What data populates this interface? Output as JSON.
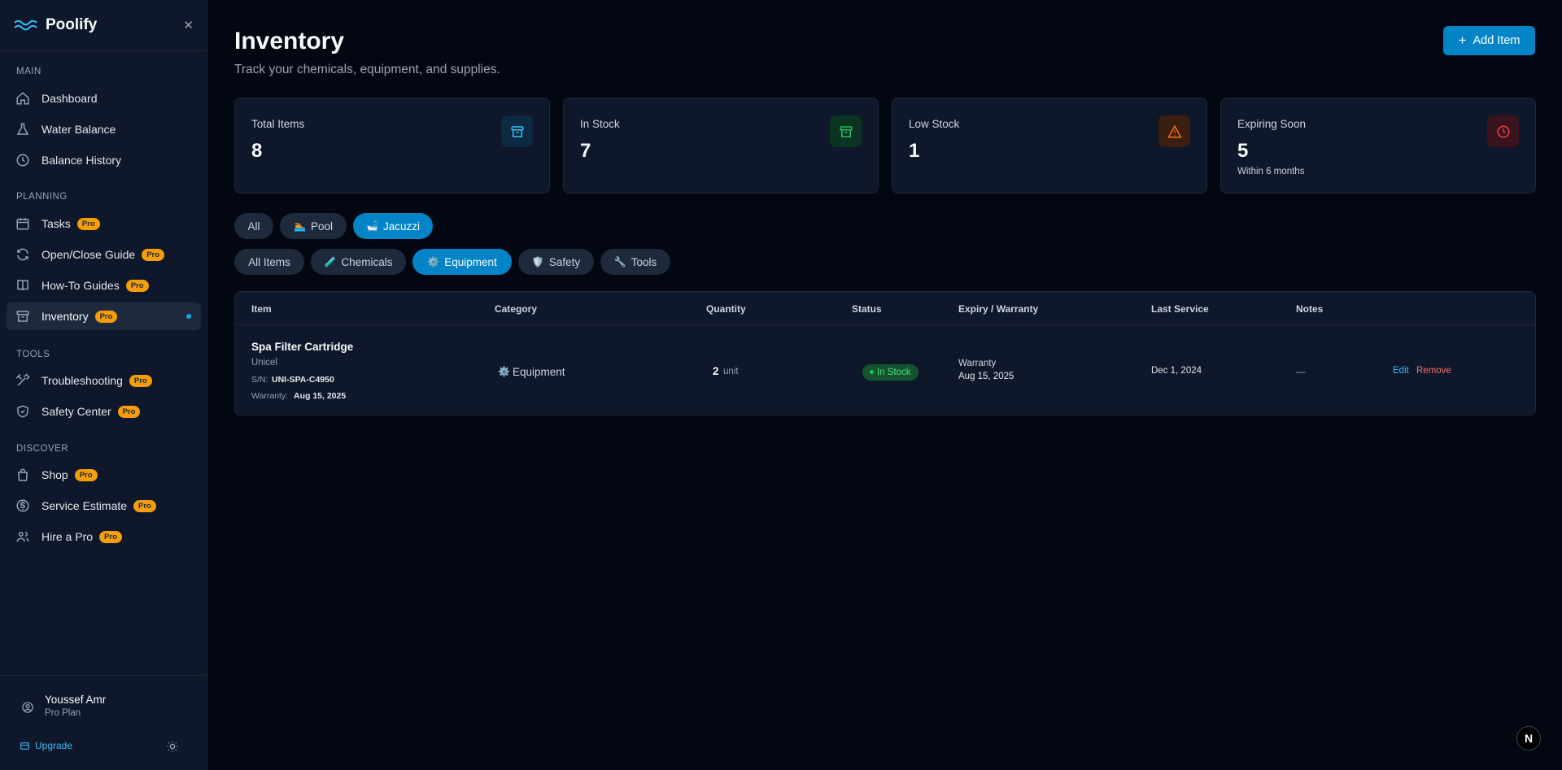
{
  "app": {
    "name": "Poolify"
  },
  "sidebar": {
    "sections": {
      "main": "MAIN",
      "planning": "PLANNING",
      "tools": "TOOLS",
      "discover": "DISCOVER"
    },
    "items": [
      {
        "label": "Dashboard",
        "icon": "home-icon",
        "pro": false
      },
      {
        "label": "Water Balance",
        "icon": "flask-icon",
        "pro": false
      },
      {
        "label": "Balance History",
        "icon": "clock-icon",
        "pro": false
      },
      {
        "label": "Tasks",
        "icon": "calendar-icon",
        "pro": true
      },
      {
        "label": "Open/Close Guide",
        "icon": "refresh-icon",
        "pro": true
      },
      {
        "label": "How-To Guides",
        "icon": "book-icon",
        "pro": true
      },
      {
        "label": "Inventory",
        "icon": "archive-icon",
        "pro": true,
        "active": true
      },
      {
        "label": "Troubleshooting",
        "icon": "tools-icon",
        "pro": true
      },
      {
        "label": "Safety Center",
        "icon": "shield-icon",
        "pro": true
      },
      {
        "label": "Shop",
        "icon": "bag-icon",
        "pro": true
      },
      {
        "label": "Service Estimate",
        "icon": "dollar-icon",
        "pro": true
      },
      {
        "label": "Hire a Pro",
        "icon": "users-icon",
        "pro": true
      }
    ],
    "pro_label": "Pro",
    "user": {
      "name": "Youssef Amr",
      "plan": "Pro Plan"
    },
    "upgrade_label": "Upgrade"
  },
  "header": {
    "title": "Inventory",
    "subtitle": "Track your chemicals, equipment, and supplies.",
    "add_label": "Add Item"
  },
  "stats": [
    {
      "title": "Total Items",
      "value": "8",
      "sub": "",
      "color": "#38bdf8",
      "bg": "#0c2a44"
    },
    {
      "title": "In Stock",
      "value": "7",
      "sub": "",
      "color": "#22c55e",
      "bg": "#0b3322"
    },
    {
      "title": "Low Stock",
      "value": "1",
      "sub": "",
      "color": "#f97316",
      "bg": "#3a1e12"
    },
    {
      "title": "Expiring Soon",
      "value": "5",
      "sub": "Within 6 months",
      "color": "#ef4444",
      "bg": "#3a131c"
    }
  ],
  "location_filters": [
    {
      "label": "All",
      "emoji": "",
      "active": false
    },
    {
      "label": "Pool",
      "emoji": "🏊",
      "active": false
    },
    {
      "label": "Jacuzzi",
      "emoji": "🛁",
      "active": true
    }
  ],
  "category_filters": [
    {
      "label": "All Items",
      "emoji": "",
      "active": false
    },
    {
      "label": "Chemicals",
      "emoji": "🧪",
      "active": false
    },
    {
      "label": "Equipment",
      "emoji": "⚙️",
      "active": true
    },
    {
      "label": "Safety",
      "emoji": "🛡️",
      "active": false
    },
    {
      "label": "Tools",
      "emoji": "🔧",
      "active": false
    }
  ],
  "table": {
    "columns": [
      "Item",
      "Category",
      "Quantity",
      "Status",
      "Expiry / Warranty",
      "Last Service",
      "Notes"
    ],
    "rows": [
      {
        "name": "Spa Filter Cartridge",
        "brand": "Unicel",
        "sn_label": "S/N:",
        "sn": "UNI-SPA-C4950",
        "warranty_label": "Warranty:",
        "warranty": "Aug 15, 2025",
        "category": "Equipment",
        "category_icon": "⚙️",
        "qty": "2",
        "unit": "unit",
        "status": "In Stock",
        "expiry_label": "Warranty",
        "expiry": "Aug 15, 2025",
        "last_service": "Dec 1, 2024",
        "notes": "—",
        "edit": "Edit",
        "remove": "Remove"
      }
    ]
  },
  "fab": {
    "label": "N"
  }
}
